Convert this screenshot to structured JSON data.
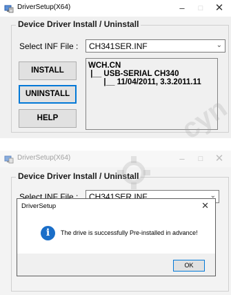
{
  "colors": {
    "accent": "#0078d7",
    "info_icon": "#1a6ec8",
    "window_bg": "#f0f0f0"
  },
  "window1": {
    "title": "DriverSetup(X64)",
    "controls": {
      "minimize": "–",
      "maximize": "□",
      "close": "✕"
    },
    "group_title": "Device Driver Install / Uninstall",
    "select_label": "Select INF File :",
    "inf_file": "CH341SER.INF",
    "buttons": {
      "install": "INSTALL",
      "uninstall": "UNINSTALL",
      "help": "HELP"
    },
    "info": {
      "line1": "WCH.CN",
      "line2": " |__ USB-SERIAL CH340",
      "line3": "       |__ 11/04/2011, 3.3.2011.11"
    }
  },
  "window2": {
    "title": "DriverSetup(X64)",
    "controls": {
      "minimize": "–",
      "maximize": "□",
      "close": "✕"
    },
    "group_title": "Device Driver Install / Uninstall",
    "select_label": "Select INF File :",
    "inf_file": "CH341SER.INF",
    "dialog": {
      "title": "DriverSetup",
      "close": "✕",
      "icon": "information-icon",
      "message": "The drive is successfully Pre-installed in advance!",
      "ok_label": "OK"
    }
  },
  "watermark": {
    "text": "cyn"
  }
}
